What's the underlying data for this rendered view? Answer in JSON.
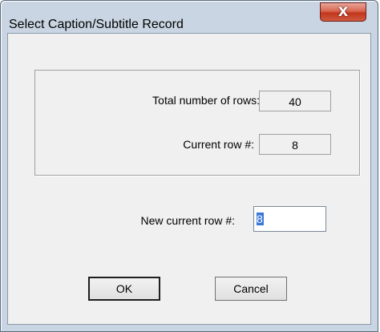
{
  "window": {
    "title": "Select Caption/Subtitle Record",
    "close_glyph": "X"
  },
  "stats": {
    "total_rows_label": "Total number of rows:",
    "total_rows_value": "40",
    "current_row_label": "Current row #:",
    "current_row_value": "8"
  },
  "new_row": {
    "label": "New current row #:",
    "value": "8"
  },
  "buttons": {
    "ok_label": "OK",
    "cancel_label": "Cancel"
  },
  "colors": {
    "close_button": "#c2361b",
    "selection": "#3a78d8"
  }
}
